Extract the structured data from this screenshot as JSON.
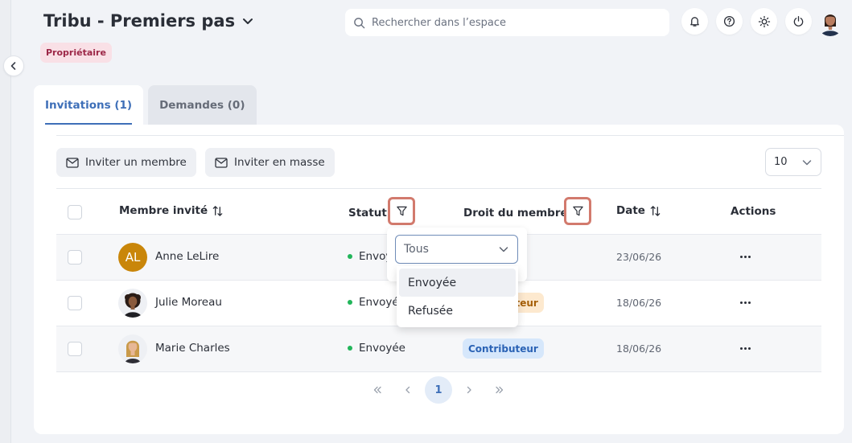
{
  "header": {
    "title": "Tribu - Premiers pas",
    "role_badge": "Propriétaire",
    "search": {
      "placeholder": "Rechercher dans l’espace"
    },
    "icons": [
      "bell-icon",
      "help-icon",
      "sun-icon",
      "power-icon"
    ]
  },
  "tabs": [
    {
      "label": "Invitations (1)",
      "active": true
    },
    {
      "label": "Demandes (0)",
      "active": false
    }
  ],
  "toolbar": {
    "invite_member": "Inviter un membre",
    "invite_bulk": "Inviter en masse",
    "page_size": "10"
  },
  "table": {
    "columns": {
      "member": "Membre invité",
      "status": "Statut",
      "role": "Droit du membre",
      "date": "Date",
      "actions": "Actions"
    },
    "rows": [
      {
        "avatar_type": "initials",
        "initials": "AL",
        "name": "Anne LeLire",
        "status": "Envoyée",
        "role": "",
        "date": "23/06/26"
      },
      {
        "avatar_type": "photo",
        "name": "Julie Moreau",
        "status": "Envoyée",
        "role": "Contributeur",
        "date": "18/06/26"
      },
      {
        "avatar_type": "photo",
        "name": "Marie Charles",
        "status": "Envoyée",
        "role": "Contributeur",
        "date": "18/06/26"
      }
    ]
  },
  "status_filter": {
    "selected": "Tous",
    "options": [
      "Envoyée",
      "Refusée"
    ]
  },
  "pagination": {
    "current": "1"
  },
  "colors": {
    "accent": "#3e6fb8",
    "badge_bg": "#f9e0e6",
    "badge_text": "#9c2747",
    "status_dot": "#22b55a",
    "filter_highlight": "#d27a6d",
    "role_blue_bg": "#d6e7fb",
    "role_orange_bg": "#fde9cf"
  }
}
